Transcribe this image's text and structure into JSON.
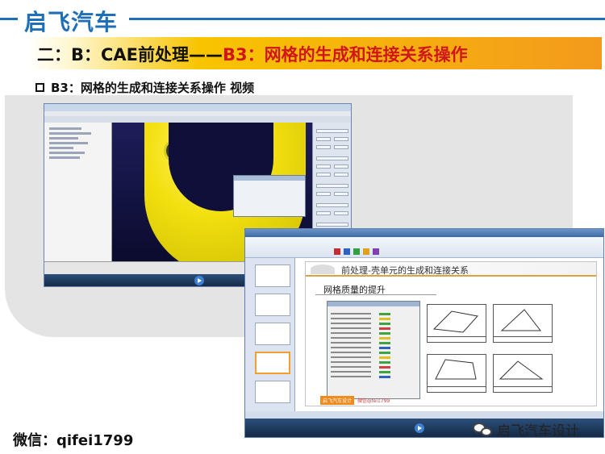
{
  "header": {
    "brand": "启飞汽车",
    "section_prefix": "二：B：CAE前处理——",
    "section_highlight": "B3：网格的生成和连接关系操作"
  },
  "bullet": {
    "text": "B3：网格的生成和连接关系操作 视频"
  },
  "slide_content": {
    "title": "前处理-壳单元的生成和连接关系",
    "subtitle": "网格质量的提升",
    "footer_brand": "启飞汽车设计",
    "footer_contact": "微信qifei1799"
  },
  "footer": {
    "wechat": "微信：qifei1799",
    "watermark": "启飞汽车设计"
  },
  "colors": {
    "brand_blue": "#1f6fb8",
    "banner_orange": "#f39a1d",
    "highlight_red": "#d0161b",
    "part_yellow": "#f2e010"
  }
}
